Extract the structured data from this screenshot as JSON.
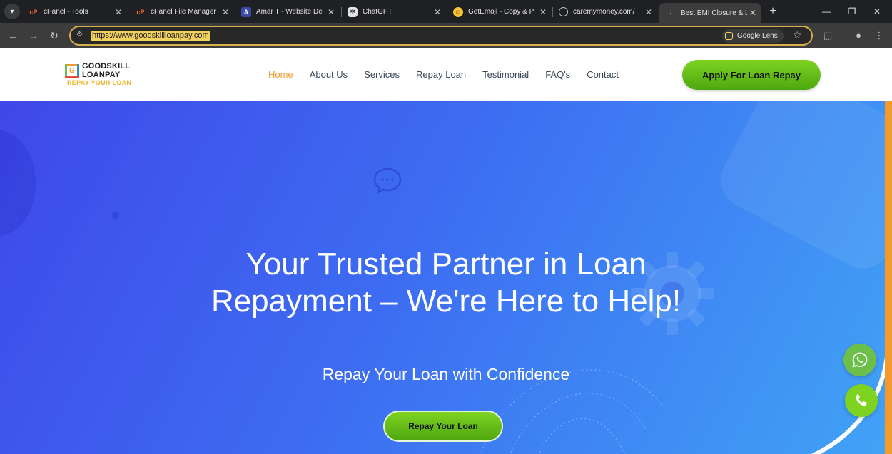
{
  "browser": {
    "tabs": [
      {
        "title": "cPanel - Tools",
        "favicon": "cpanel-icon",
        "active": false
      },
      {
        "title": "cPanel File Manager",
        "favicon": "cpanel-icon",
        "active": false
      },
      {
        "title": "Amar T - Website De",
        "favicon": "app-icon",
        "active": false
      },
      {
        "title": "ChatGPT",
        "favicon": "chatgpt-icon",
        "active": false
      },
      {
        "title": "GetEmoji - Copy & P",
        "favicon": "emoji-icon",
        "active": false
      },
      {
        "title": "caremymoney.com/",
        "favicon": "globe-icon",
        "active": false
      },
      {
        "title": "Best EMI Closure & L",
        "favicon": "loading-icon",
        "active": true
      }
    ],
    "tab_close": "✕",
    "new_tab": "+",
    "url": "https://www.goodskillloanpay.com",
    "lens_label": "Google Lens"
  },
  "site": {
    "logo": {
      "mark": "G",
      "line1": "GOODSKILL",
      "line2": "LOANPAY",
      "tagline": "REPAY YOUR LOAN"
    },
    "nav": [
      {
        "label": "Home",
        "active": true
      },
      {
        "label": "About Us",
        "active": false
      },
      {
        "label": "Services",
        "active": false
      },
      {
        "label": "Repay Loan",
        "active": false
      },
      {
        "label": "Testimonial",
        "active": false
      },
      {
        "label": "FAQ's",
        "active": false
      },
      {
        "label": "Contact",
        "active": false
      }
    ],
    "apply_button": "Apply For Loan Repay"
  },
  "hero": {
    "title": "Your Trusted Partner in Loan Repayment – We're Here to Help!",
    "subtitle": "Repay Your Loan with Confidence",
    "cta": "Repay Your Loan"
  },
  "colors": {
    "accent_orange": "#f39a2b",
    "button_green": "#6cc04a",
    "hero_blue": "#3d6cf2"
  }
}
